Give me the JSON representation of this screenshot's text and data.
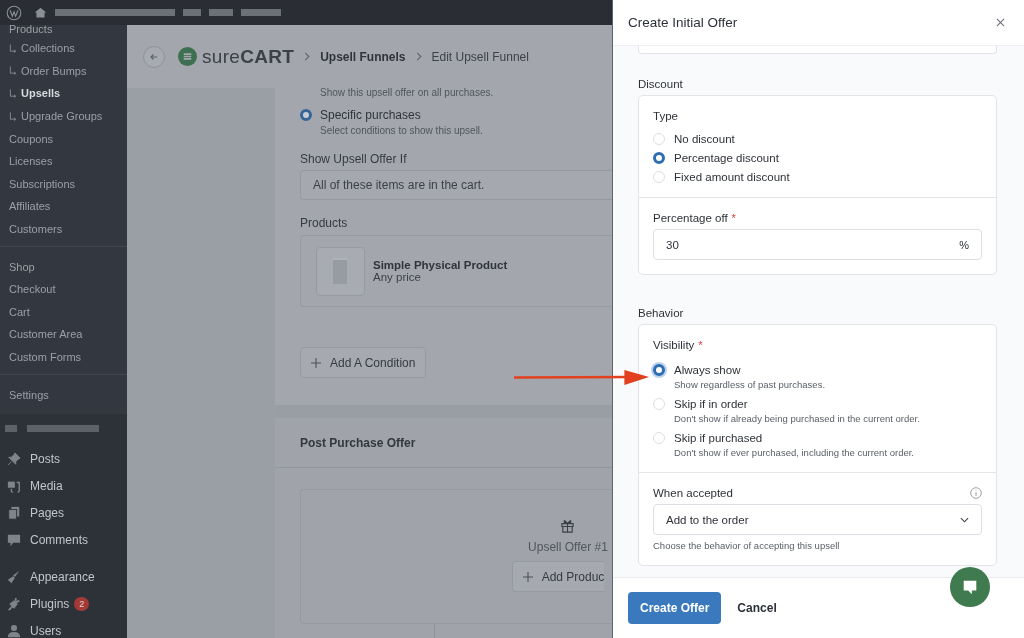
{
  "sidebar": {
    "submenu": [
      {
        "label": "Products",
        "sub": false,
        "selected": false
      },
      {
        "label": "Collections",
        "sub": true,
        "selected": false
      },
      {
        "label": "Order Bumps",
        "sub": true,
        "selected": false
      },
      {
        "label": "Upsells",
        "sub": true,
        "selected": true
      },
      {
        "label": "Upgrade Groups",
        "sub": true,
        "selected": false
      },
      {
        "label": "Coupons",
        "sub": false,
        "selected": false
      },
      {
        "label": "Licenses",
        "sub": false,
        "selected": false
      },
      {
        "label": "Subscriptions",
        "sub": false,
        "selected": false
      },
      {
        "label": "Affiliates",
        "sub": false,
        "selected": false
      },
      {
        "label": "Customers",
        "sub": false,
        "selected": false
      }
    ],
    "submenu_2": [
      "Shop",
      "Checkout",
      "Cart",
      "Customer Area",
      "Custom Forms"
    ],
    "settings": "Settings",
    "menu": [
      {
        "label": "Posts"
      },
      {
        "label": "Media"
      },
      {
        "label": "Pages"
      },
      {
        "label": "Comments"
      },
      {
        "label": "Appearance"
      },
      {
        "label": "Plugins",
        "badge": "2"
      },
      {
        "label": "Users"
      }
    ]
  },
  "header": {
    "logo": "sure**CART**",
    "breadcrumbs": [
      "Upsell Funnels",
      "Edit Upsell Funnel"
    ]
  },
  "conditions": {
    "hint": "Show this upsell offer on all purchases.",
    "option": {
      "label": "Specific purchases",
      "description": "Select conditions to show this upsell.",
      "selected": true
    },
    "rule_label": "Show Upsell Offer If",
    "rule_value": "All of these items are in the cart.",
    "products_label": "Products",
    "product": {
      "name": "Simple Physical Product",
      "price": "Any price"
    },
    "add_condition": "Add A Condition"
  },
  "post_purchase": {
    "title": "Post Purchase Offer",
    "offer_label": "Upsell Offer #1",
    "add_product": "Add Produc"
  },
  "drawer": {
    "title": "Create Initial Offer",
    "discount": {
      "title": "Discount",
      "type_label": "Type",
      "options": [
        {
          "label": "No discount",
          "selected": false
        },
        {
          "label": "Percentage discount",
          "selected": true
        },
        {
          "label": "Fixed amount discount",
          "selected": false
        }
      ],
      "amount_label": "Percentage off",
      "required_mark": "*",
      "value": "30",
      "suffix": "%"
    },
    "behavior": {
      "title": "Behavior",
      "visibility_label": "Visibility",
      "required_mark": "*",
      "options": [
        {
          "label": "Always show",
          "description": "Show regardless of past purchases.",
          "selected": true
        },
        {
          "label": "Skip if in order",
          "description": "Don't show if already being purchased in the current order.",
          "selected": false
        },
        {
          "label": "Skip if purchased",
          "description": "Don't show if ever purchased, including the current order.",
          "selected": false
        }
      ],
      "accepted_label": "When accepted",
      "accepted_value": "Add to the order",
      "help": "Choose the behavior of accepting this upsell"
    },
    "buttons": [
      "Create Offer",
      "Cancel"
    ]
  }
}
